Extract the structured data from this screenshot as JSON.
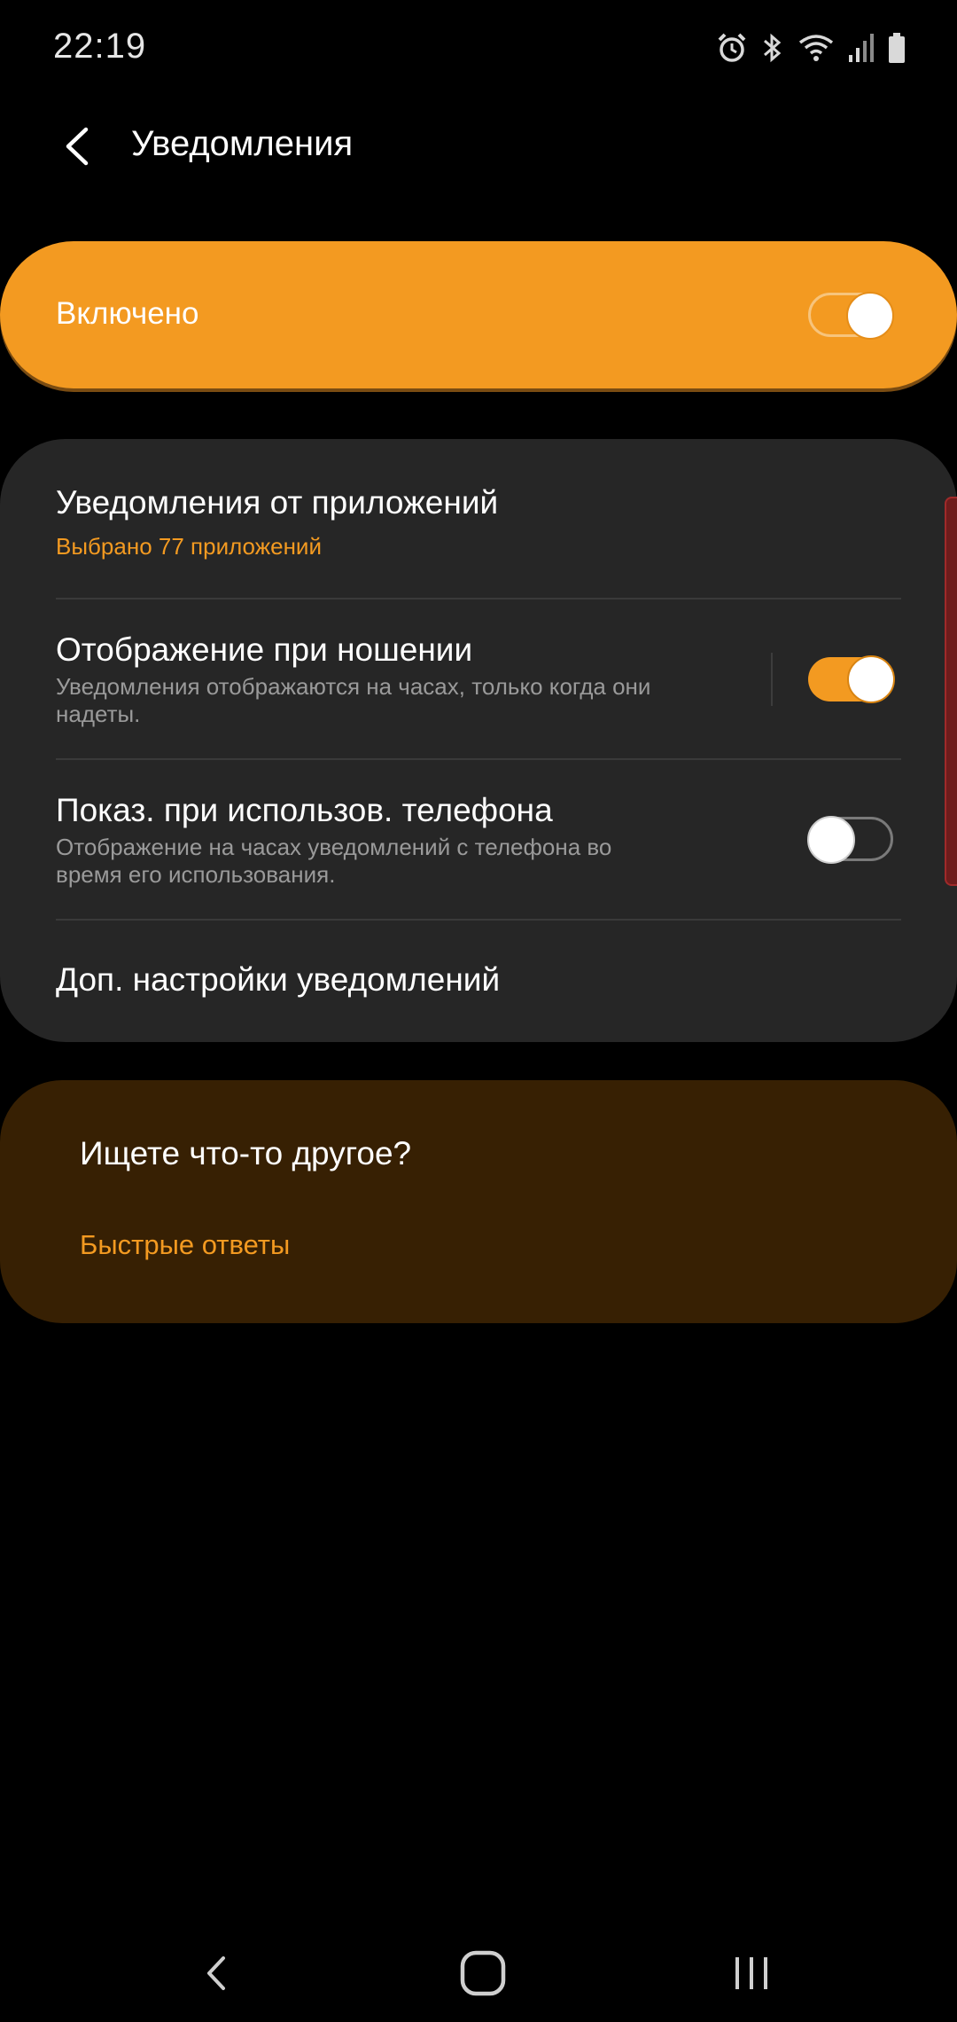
{
  "status_bar": {
    "time": "22:19",
    "icons": [
      "alarm-icon",
      "bluetooth-icon",
      "wifi-icon",
      "signal-icon",
      "battery-icon"
    ]
  },
  "app_bar": {
    "title": "Уведомления"
  },
  "master_switch": {
    "label": "Включено",
    "on": true
  },
  "settings": {
    "app_notifications": {
      "title": "Уведомления от приложений",
      "subtitle": "Выбрано 77 приложений"
    },
    "show_when_wearing": {
      "title": "Отображение при ношении",
      "subtitle": "Уведомления отображаются на часах, только когда они надеты.",
      "on": true
    },
    "show_when_using_phone": {
      "title": "Показ. при использов. телефона",
      "subtitle": "Отображение на часах уведомлений с телефона во время его использования.",
      "on": false
    },
    "advanced": {
      "title": "Доп. настройки уведомлений"
    }
  },
  "suggestions": {
    "title": "Ищете что-то другое?",
    "link": "Быстрые ответы"
  },
  "nav_bar": {
    "icons": [
      "back-icon",
      "home-icon",
      "recents-icon"
    ]
  },
  "colors": {
    "accent": "#f39a21",
    "card": "#262626",
    "suggest_card": "#372003",
    "background": "#000000"
  }
}
